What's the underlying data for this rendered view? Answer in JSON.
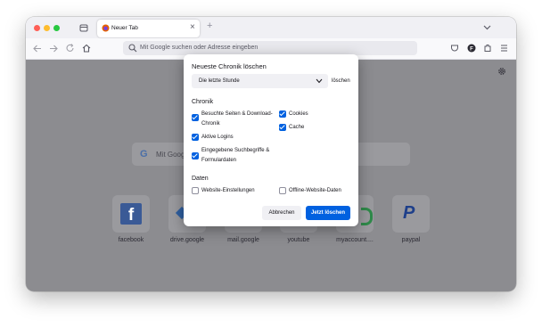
{
  "tab": {
    "title": "Neuer Tab",
    "close": "×",
    "new": "+"
  },
  "urlbar": {
    "placeholder": "Mit Google suchen oder Adresse eingeben"
  },
  "content_search": {
    "placeholder": "Mit Google suchen oder Adresse eingeben"
  },
  "top_sites": [
    {
      "label": "facebook"
    },
    {
      "label": "drive.google"
    },
    {
      "label": "mail.google"
    },
    {
      "label": "youtube"
    },
    {
      "label": "myaccount...."
    },
    {
      "label": "paypal"
    }
  ],
  "dialog": {
    "title": "Neueste Chronik löschen",
    "range_selected": "Die letzte Stunde",
    "range_action": "löschen",
    "history_heading": "Chronik",
    "opt_browsing_line1": "Besuchte Seiten & Download-",
    "opt_browsing_line2": "Chronik",
    "opt_cookies": "Cookies",
    "opt_logins": "Aktive Logins",
    "opt_cache": "Cache",
    "opt_forms_line1": "Eingegebene Suchbegriffe &",
    "opt_forms_line2": "Formulardaten",
    "data_heading": "Daten",
    "opt_site_settings": "Website-Einstellungen",
    "opt_offline": "Offline-Website-Daten",
    "cancel": "Abbrechen",
    "confirm": "Jetzt löschen"
  },
  "colors": {
    "accent": "#0061e0",
    "traffic_red": "#ff5f57",
    "traffic_yellow": "#febc2e",
    "traffic_green": "#28c840"
  }
}
